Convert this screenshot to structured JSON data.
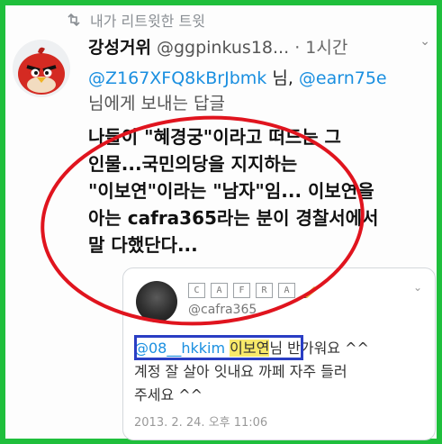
{
  "retweet": {
    "label": "내가 리트윗한 트윗",
    "icon": "retweet-icon"
  },
  "author": {
    "name": "강성거위",
    "handle": "@ggpinkus18...",
    "separator": "·",
    "time": "1시간"
  },
  "reply": {
    "mention1": "@Z167XFQ8kBrJbmk",
    "suffix1": " 님, ",
    "mention2": "@earn75e",
    "line2": "님에게 보내는 답글"
  },
  "tweet_lines": [
    "나들이 \"혜경궁\"이라고 떠드는 그",
    "인물...국민의당을 지지하는",
    "\"이보연\"이라는 \"남자\"임... 이보연을",
    "아는 cafra365라는 분이 경찰서에서",
    "말 다했단다..."
  ],
  "quoted": {
    "logo_letters": [
      "C",
      "A",
      "F",
      "R",
      "A"
    ],
    "handle": "@cafra365",
    "mention": "@08__hkkim",
    "highlight": "이보연",
    "line1_rest": "님 반가워요 ^^",
    "line2": "계정 잘 살아 잇내요 까페 자주 들러",
    "line3": "주세요 ^^",
    "date": "2013. 2. 24. 오후 11:06"
  },
  "colors": {
    "frame": "#1fbf3c",
    "mention": "#1a8fe0",
    "annotation_circle": "#e0141e",
    "annotation_box": "#2a3ec4",
    "highlight": "#f8e96a"
  }
}
